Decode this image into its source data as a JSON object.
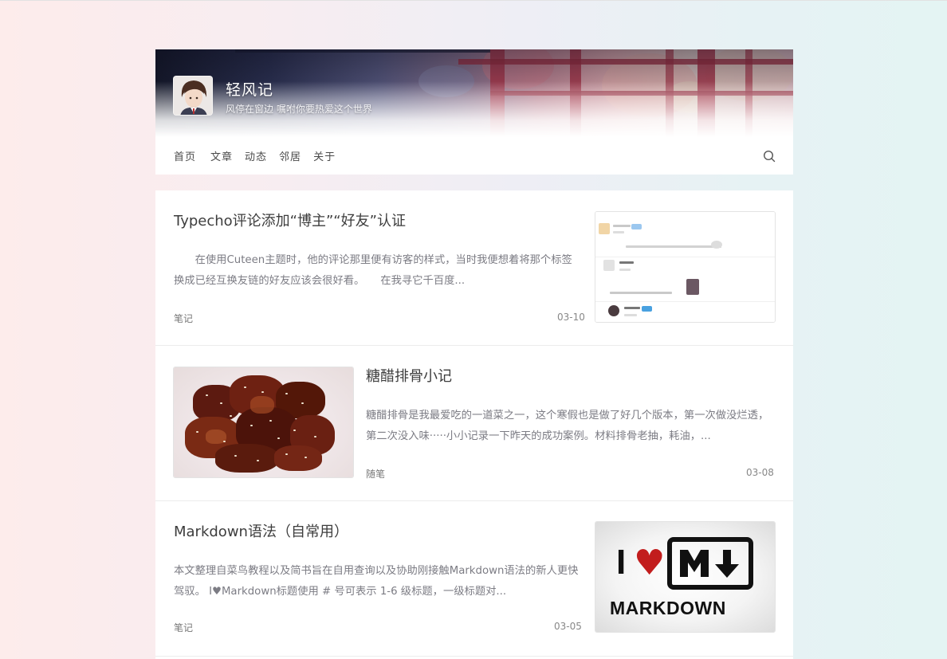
{
  "site": {
    "title": "轻风记",
    "description": "风停在窗边 嘱咐你要热爱这个世界"
  },
  "nav": {
    "items": [
      "首页",
      "文章",
      "动态",
      "邻居",
      "关于"
    ]
  },
  "icons": {
    "search": "search-icon",
    "avatar": "avatar-image"
  },
  "colors": {
    "accent": "#3d3d3d",
    "meta": "#888888",
    "excerpt": "#7c7c84"
  },
  "posts": [
    {
      "title": "Typecho评论添加“博主”“好友”认证",
      "excerpt": "　　在使用Cuteen主题时，他的评论那里便有访客的样式，当时我便想着将那个标签换成已经互换友链的好友应该会很好看。　　在我寻它千百度...",
      "category": "笔记",
      "date": "03-10",
      "thumb": "comment-screenshot"
    },
    {
      "title": "糖醋排骨小记",
      "excerpt": "糖醋排骨是我最爱吃的一道菜之一，这个寒假也是做了好几个版本，第一次做没烂透，第二次没入味·····小小记录一下昨天的成功案例。材料排骨老抽，耗油，...",
      "category": "随笔",
      "date": "03-08",
      "thumb": "sweet-sour-ribs"
    },
    {
      "title": "Markdown语法（自常用）",
      "excerpt": "本文整理自菜鸟教程以及简书旨在自用查询以及协助刚接触Markdown语法的新人更快驾驭。 I♥Markdown标题使用 # 号可表示 1-6 级标题，一级标题对...",
      "category": "笔记",
      "date": "03-05",
      "thumb": "markdown-logo",
      "thumb_text": {
        "i": "I",
        "heart": "♥",
        "word": "MARKDOWN"
      }
    }
  ]
}
